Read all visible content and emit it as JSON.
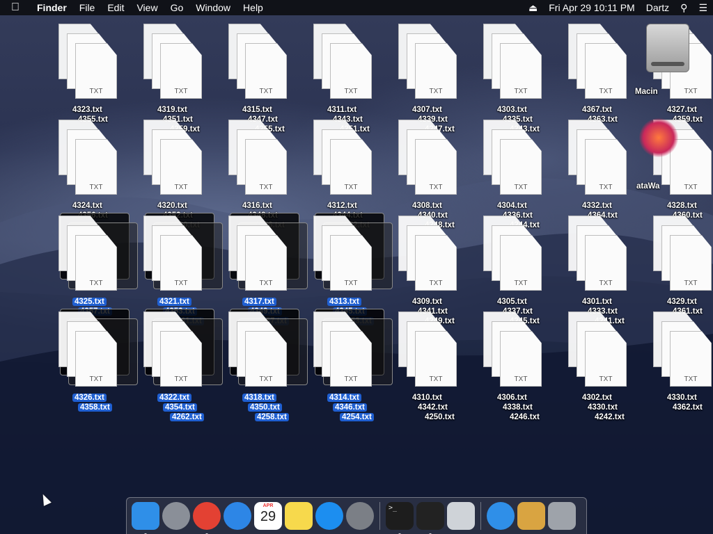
{
  "menubar": {
    "app": "Finder",
    "menus": [
      "File",
      "Edit",
      "View",
      "Go",
      "Window",
      "Help"
    ],
    "datetime": "Fri Apr 29  10:11 PM",
    "user": "Dartz"
  },
  "desktop": {
    "file_ext": "TXT",
    "stacks": [
      {
        "labels": [
          "4323.txt",
          "4355.txt"
        ],
        "sel": false
      },
      {
        "labels": [
          "4319.txt",
          "4351.txt",
          "4259.txt"
        ],
        "sel": false
      },
      {
        "labels": [
          "4315.txt",
          "4347.txt",
          "4255.txt"
        ],
        "sel": false
      },
      {
        "labels": [
          "4311.txt",
          "4343.txt",
          "4251.txt"
        ],
        "sel": false
      },
      {
        "labels": [
          "4307.txt",
          "4339.txt",
          "4247.txt"
        ],
        "sel": false
      },
      {
        "labels": [
          "4303.txt",
          "4335.txt",
          "4243.txt"
        ],
        "sel": false
      },
      {
        "labels": [
          "4367.txt",
          "4363.txt"
        ],
        "sel": false
      },
      {
        "labels": [
          "4327.txt",
          "4359.txt"
        ],
        "sel": false
      },
      {
        "labels": [
          "4324.txt",
          "4356.txt"
        ],
        "sel": false
      },
      {
        "labels": [
          "4320.txt",
          "4352.txt",
          "4260.txt"
        ],
        "sel": false
      },
      {
        "labels": [
          "4316.txt",
          "4348.txt",
          "4256.txt"
        ],
        "sel": false
      },
      {
        "labels": [
          "4312.txt",
          "4344.txt",
          "4252.txt"
        ],
        "sel": false
      },
      {
        "labels": [
          "4308.txt",
          "4340.txt",
          "4248.txt"
        ],
        "sel": false
      },
      {
        "labels": [
          "4304.txt",
          "4336.txt",
          "4244.txt"
        ],
        "sel": false
      },
      {
        "labels": [
          "4332.txt",
          "4364.txt"
        ],
        "sel": false
      },
      {
        "labels": [
          "4328.txt",
          "4360.txt"
        ],
        "sel": false
      },
      {
        "labels": [
          "4325.txt",
          "4357.txt"
        ],
        "sel": true
      },
      {
        "labels": [
          "4321.txt",
          "4353.txt",
          "4261.txt"
        ],
        "sel": true
      },
      {
        "labels": [
          "4317.txt",
          "4349.txt",
          "4257.txt"
        ],
        "sel": true
      },
      {
        "labels": [
          "4313.txt",
          "4345.txt",
          "4253.txt"
        ],
        "sel": true
      },
      {
        "labels": [
          "4309.txt",
          "4341.txt",
          "4249.txt"
        ],
        "sel": false
      },
      {
        "labels": [
          "4305.txt",
          "4337.txt",
          "4245.txt"
        ],
        "sel": false
      },
      {
        "labels": [
          "4301.txt",
          "4333.txt",
          "4241.txt"
        ],
        "sel": false
      },
      {
        "labels": [
          "4329.txt",
          "4361.txt"
        ],
        "sel": false
      },
      {
        "labels": [
          "4326.txt",
          "4358.txt"
        ],
        "sel": true
      },
      {
        "labels": [
          "4322.txt",
          "4354.txt",
          "4262.txt"
        ],
        "sel": true
      },
      {
        "labels": [
          "4318.txt",
          "4350.txt",
          "4258.txt"
        ],
        "sel": true
      },
      {
        "labels": [
          "4314.txt",
          "4346.txt",
          "4254.txt"
        ],
        "sel": true
      },
      {
        "labels": [
          "4310.txt",
          "4342.txt",
          "4250.txt"
        ],
        "sel": false
      },
      {
        "labels": [
          "4306.txt",
          "4338.txt",
          "4246.txt"
        ],
        "sel": false
      },
      {
        "labels": [
          "4302.txt",
          "4330.txt",
          "4242.txt"
        ],
        "sel": false
      },
      {
        "labels": [
          "4330.txt",
          "4362.txt"
        ],
        "sel": false
      }
    ],
    "disk_label": "Macin",
    "app_label": "ataWa"
  },
  "dock": {
    "items": [
      {
        "name": "finder",
        "color": "#2f8fe8",
        "running": true
      },
      {
        "name": "launchpad",
        "color": "#8a8f98",
        "running": false
      },
      {
        "name": "chrome",
        "color": "#e34133",
        "running": true
      },
      {
        "name": "safari",
        "color": "#2d86e6",
        "running": false
      },
      {
        "name": "calendar",
        "color": "#ffffff",
        "running": false,
        "month": "APR",
        "day": "29"
      },
      {
        "name": "notes",
        "color": "#f7d94c",
        "running": false
      },
      {
        "name": "app-store",
        "color": "#1c8ef0",
        "running": false
      },
      {
        "name": "system-preferences",
        "color": "#7b7f86",
        "running": false
      },
      {
        "sep": true
      },
      {
        "name": "terminal",
        "color": "#1d1d1d",
        "running": true
      },
      {
        "name": "activity-monitor",
        "color": "#222",
        "running": true
      },
      {
        "name": "network-utility",
        "color": "#cfd3d8",
        "running": false
      },
      {
        "sep": true
      },
      {
        "name": "app-store-downloads",
        "color": "#2f8fe8",
        "running": false
      },
      {
        "name": "archive-utility",
        "color": "#d9a441",
        "running": false
      },
      {
        "name": "trash",
        "color": "#9ea3aa",
        "running": false
      }
    ]
  }
}
